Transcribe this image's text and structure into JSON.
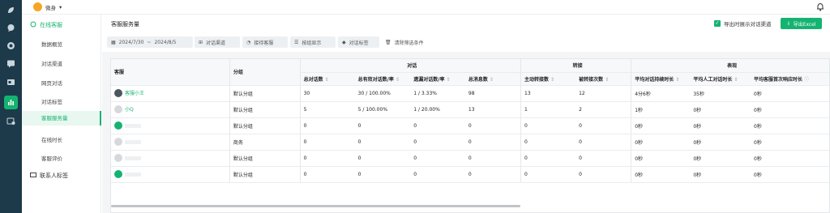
{
  "brand": {
    "name": "微身"
  },
  "rail_icons": [
    "leaf-icon",
    "chat-icon",
    "bubble-icon",
    "message-icon",
    "contact-card-icon",
    "bar-chart-icon",
    "settings-card-icon"
  ],
  "sidebar": {
    "group1": "在线客服",
    "items": [
      "数据概览",
      "对话渠道",
      "网页对话",
      "对话标签",
      "客服服务量",
      "在线时长",
      "客服评价"
    ],
    "group2": "联系人标签"
  },
  "header": {
    "title": "客服服务量",
    "checkbox_label": "导出时展示对话渠道",
    "export_label": "导出Excel"
  },
  "filters": {
    "date_from": "2024/7/30",
    "date_sep": "~",
    "date_to": "2024/8/5",
    "channel": "对话渠道",
    "agent": "接待客服",
    "display": "按组显示",
    "tag": "对话标签",
    "clear": "清除筛选条件"
  },
  "table": {
    "group_headers": {
      "agent": "客服",
      "group": "分组",
      "dialog": "对话",
      "transfer": "转接",
      "perf": "表现"
    },
    "columns": [
      "总对话数",
      "总有效对话数/率",
      "遗漏对话数/率",
      "总消息数",
      "主动转接数",
      "被转接次数",
      "平均对话持续时长",
      "平均人工对话时长",
      "平均客服首次响应时长"
    ],
    "rows": [
      {
        "name": "客服小王",
        "group": "默认分组",
        "cells": [
          "30",
          "30 / 100.00%",
          "1 / 3.33%",
          "98",
          "13",
          "12",
          "4分6秒",
          "35秒",
          "0秒"
        ]
      },
      {
        "name": "小Q",
        "group": "默认分组",
        "cells": [
          "5",
          "5 / 100.00%",
          "1 / 20.00%",
          "13",
          "1",
          "2",
          "1秒",
          "0秒",
          "0秒"
        ]
      },
      {
        "name": "",
        "group": "默认分组",
        "cells": [
          "0",
          "0",
          "0",
          "0",
          "0",
          "0",
          "0秒",
          "0秒",
          "0秒"
        ]
      },
      {
        "name": "",
        "group": "商务",
        "cells": [
          "0",
          "0",
          "0",
          "0",
          "0",
          "0",
          "0秒",
          "0秒",
          "0秒"
        ]
      },
      {
        "name": "",
        "group": "默认分组",
        "cells": [
          "0",
          "0",
          "0",
          "0",
          "0",
          "0",
          "0秒",
          "0秒",
          "0秒"
        ]
      },
      {
        "name": "",
        "group": "默认分组",
        "cells": [
          "0",
          "0",
          "0",
          "0",
          "0",
          "0",
          "0秒",
          "0秒",
          "0秒"
        ]
      }
    ]
  },
  "colors": {
    "accent": "#15b371",
    "rail": "#1d3a4a"
  }
}
